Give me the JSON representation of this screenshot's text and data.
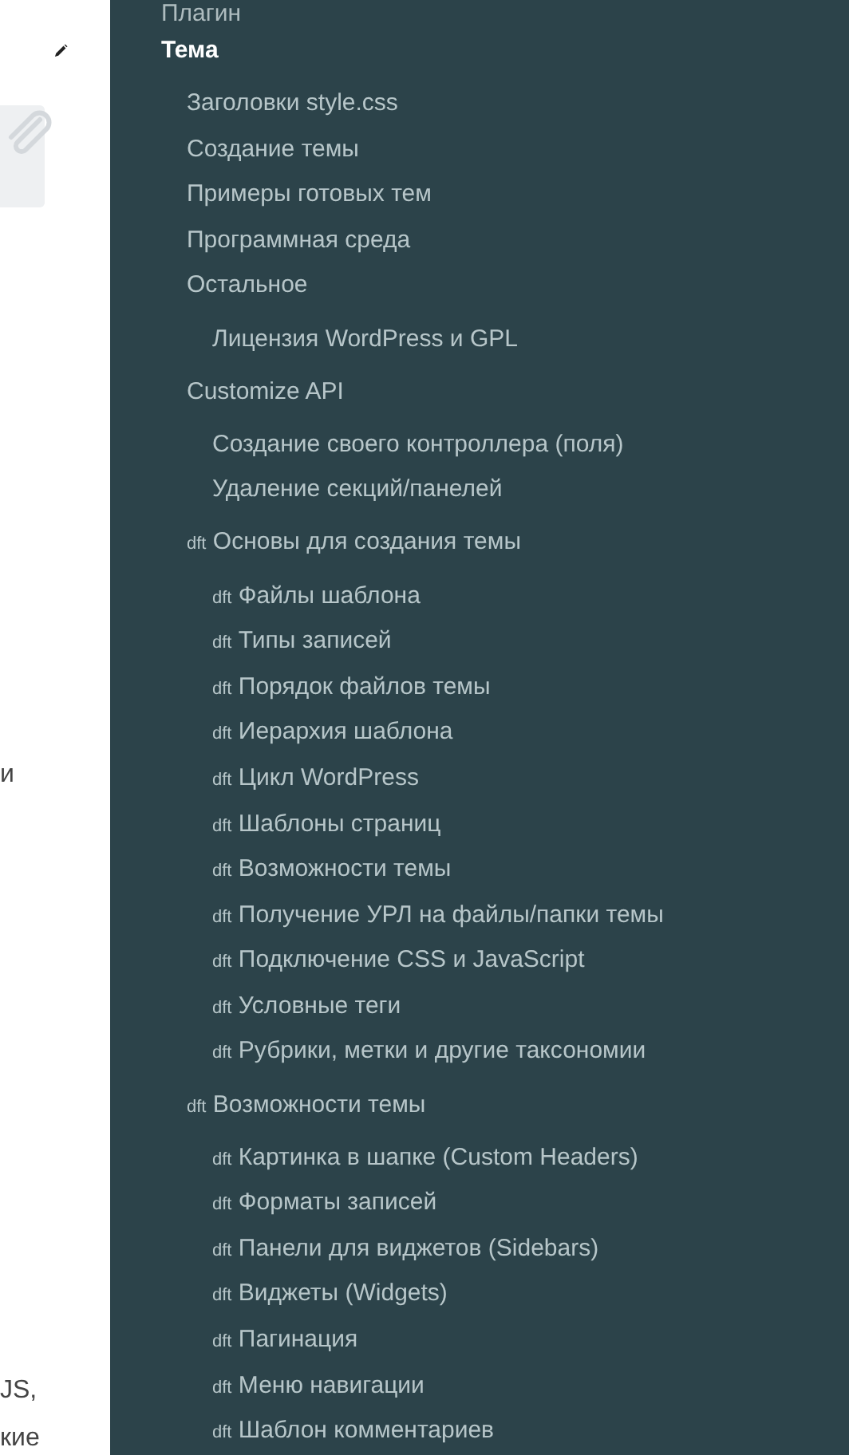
{
  "content": {
    "fragments": [
      {
        "text": "и"
      },
      {
        "text": "JS,"
      },
      {
        "text": "кие"
      }
    ]
  },
  "sections": [
    {
      "label": "Плагин",
      "selected": false
    },
    {
      "label": "Тема",
      "selected": true,
      "children": [
        {
          "label": "Заголовки style.css"
        },
        {
          "label": "Создание темы"
        },
        {
          "label": "Примеры готовых тем"
        },
        {
          "label": "Программная среда"
        },
        {
          "label": "Остальное",
          "children": [
            {
              "label": "Лицензия WordPress и GPL"
            }
          ]
        },
        {
          "label": "Customize API",
          "children": [
            {
              "label": "Создание своего контроллера (поля)"
            },
            {
              "label": "Удаление секций/панелей"
            }
          ]
        },
        {
          "badge": "dft",
          "label": "Основы для создания темы",
          "children": [
            {
              "badge": "dft",
              "label": "Файлы шаблона"
            },
            {
              "badge": "dft",
              "label": "Типы записей"
            },
            {
              "badge": "dft",
              "label": "Порядок файлов темы"
            },
            {
              "badge": "dft",
              "label": "Иерархия шаблона"
            },
            {
              "badge": "dft",
              "label": "Цикл WordPress"
            },
            {
              "badge": "dft",
              "label": "Шаблоны страниц"
            },
            {
              "badge": "dft",
              "label": "Возможности темы"
            },
            {
              "badge": "dft",
              "label": "Получение УРЛ на файлы/папки темы"
            },
            {
              "badge": "dft",
              "label": "Подключение CSS и JavaScript"
            },
            {
              "badge": "dft",
              "label": "Условные теги"
            },
            {
              "badge": "dft",
              "label": "Рубрики, метки и другие таксономии"
            }
          ]
        },
        {
          "badge": "dft",
          "label": "Возможности темы",
          "children": [
            {
              "badge": "dft",
              "label": "Картинка в шапке (Custom Headers)"
            },
            {
              "badge": "dft",
              "label": "Форматы записей"
            },
            {
              "badge": "dft",
              "label": "Панели для виджетов (Sidebars)"
            },
            {
              "badge": "dft",
              "label": "Виджеты (Widgets)"
            },
            {
              "badge": "dft",
              "label": "Пагинация"
            },
            {
              "badge": "dft",
              "label": "Меню навигации"
            },
            {
              "badge": "dft",
              "label": "Шаблон комментариев"
            }
          ]
        }
      ]
    }
  ]
}
